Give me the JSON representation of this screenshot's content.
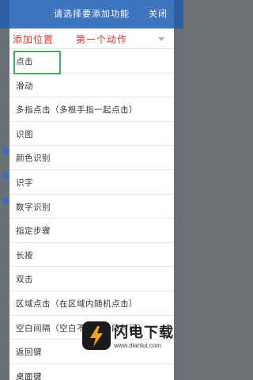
{
  "dialog": {
    "title": "请选择要添加功能",
    "close_label": "关闭",
    "position_label": "添加位置",
    "position_value": "第一个动作"
  },
  "actions": [
    "点击",
    "滑动",
    "多指点击（多根手指一起点击）",
    "识图",
    "颜色识别",
    "识字",
    "数字识别",
    "指定步骤",
    "长按",
    "双击",
    "区域点击（在区域内随机点击）",
    "空白间隔（空白不操作一段时间）",
    "返回键",
    "桌面键"
  ],
  "selected_index": 0,
  "watermark": {
    "name": "闪电下载",
    "url": "www.dianlut.com"
  },
  "colors": {
    "header": "#3f74bf",
    "accent_red": "#d9342b",
    "selection": "#2fbf5a"
  }
}
